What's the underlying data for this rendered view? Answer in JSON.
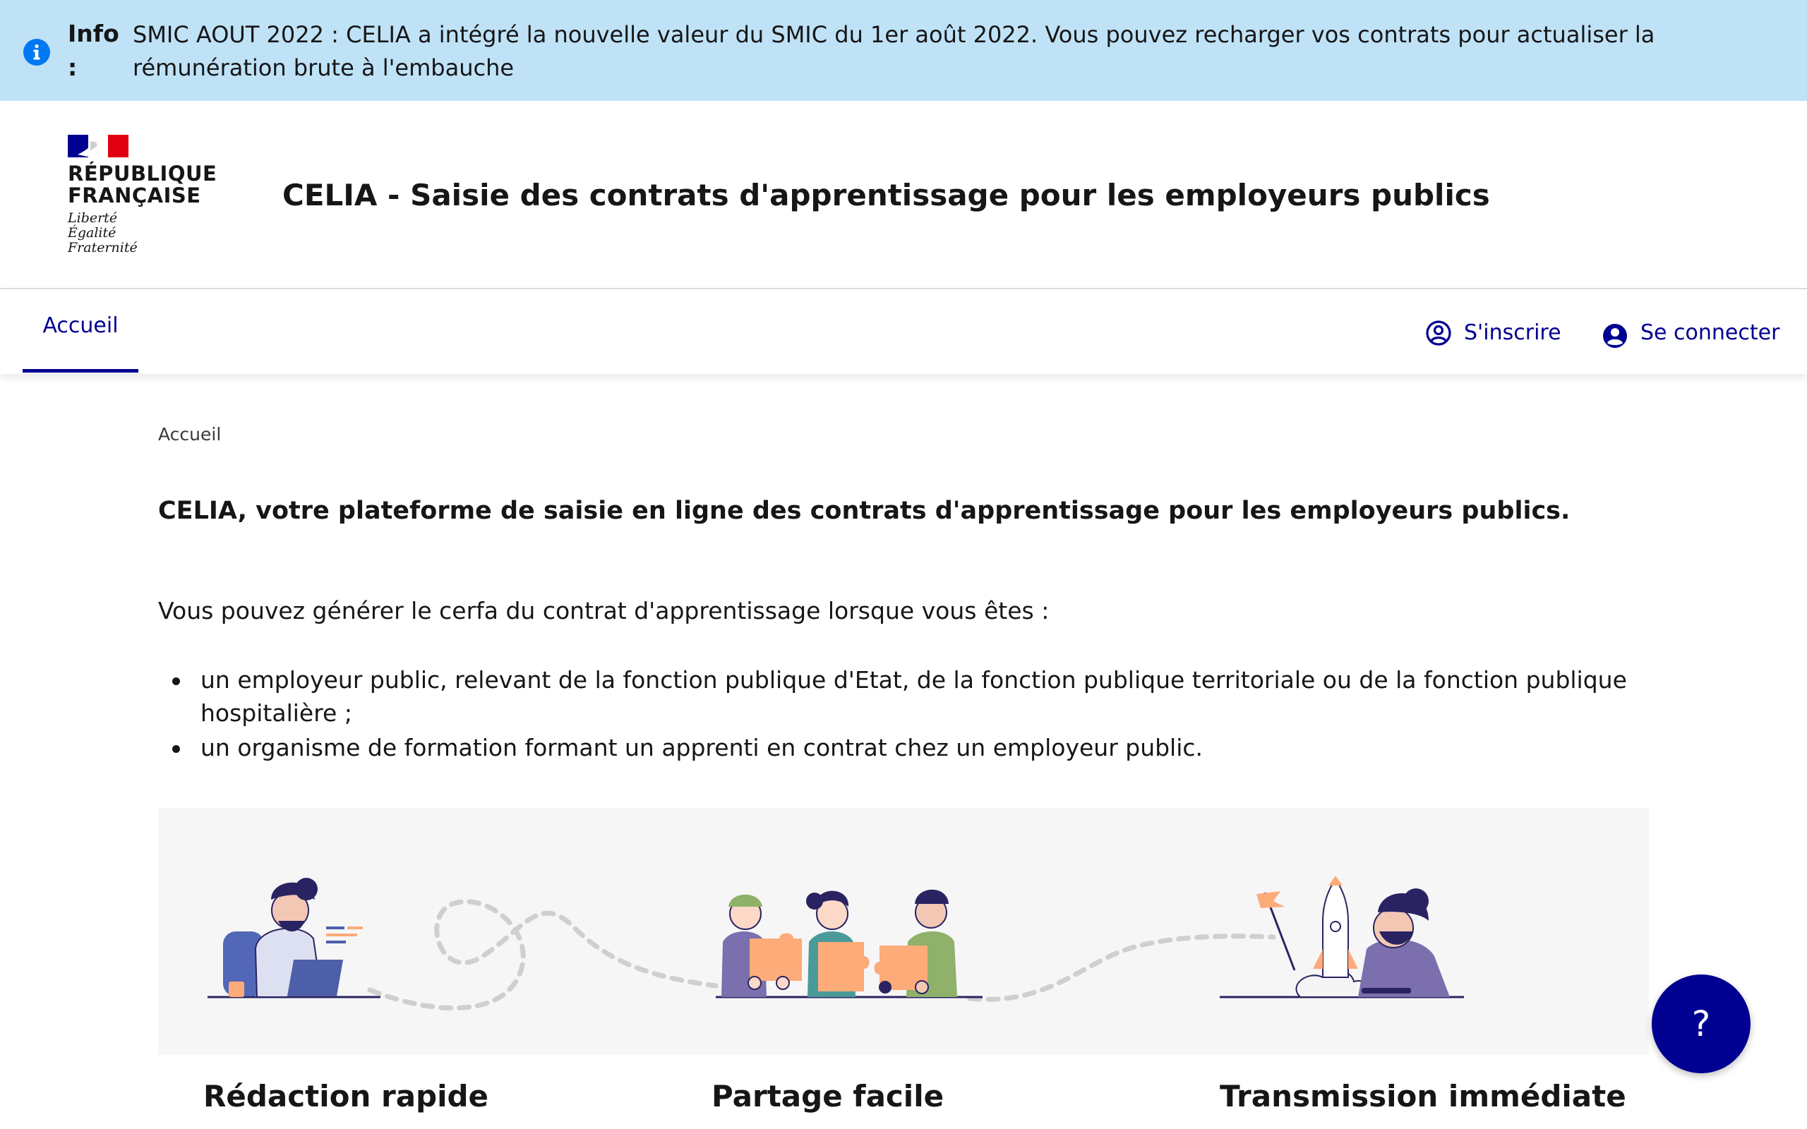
{
  "notice": {
    "title": "Info :",
    "text": "SMIC AOUT 2022 : CELIA a intégré la nouvelle valeur du SMIC du 1er août 2022. Vous pouvez recharger vos contrats pour actualiser la rémunération brute à l'embauche",
    "icon": "info-icon"
  },
  "header": {
    "logo_line1": "RÉPUBLIQUE",
    "logo_line2": "FRANÇAISE",
    "devise1": "Liberté",
    "devise2": "Égalité",
    "devise3": "Fraternité",
    "service_title": "CELIA - Saisie des contrats d'apprentissage pour les employeurs publics"
  },
  "nav": {
    "home_label": "Accueil",
    "signup_label": "S'inscrire",
    "signup_icon": "user-circle-outline-icon",
    "login_label": "Se connecter",
    "login_icon": "user-circle-filled-icon"
  },
  "main": {
    "breadcrumb": "Accueil",
    "lead": "CELIA, votre plateforme de saisie en ligne des contrats d'apprentissage pour les employeurs publics.",
    "intro": "Vous pouvez générer le cerfa du contrat d'apprentissage lorsque vous êtes :",
    "bullets": [
      "un employeur public, relevant de la fonction publique d'Etat, de la fonction publique territoriale ou de la fonction publique hospitalière ;",
      "un organisme de formation formant un apprenti en contrat chez un employeur public."
    ],
    "features": [
      {
        "title": "Rédaction rapide"
      },
      {
        "title": "Partage facile"
      },
      {
        "title": "Transmission immédiate"
      }
    ]
  },
  "help": {
    "label": "?"
  },
  "colors": {
    "primary": "#000091",
    "notice_bg": "#bfe2f7",
    "info_blue": "#0078f3",
    "flag_red": "#e1000f",
    "illustration_orange": "#fcab79",
    "illustration_purple": "#7b6fae"
  }
}
